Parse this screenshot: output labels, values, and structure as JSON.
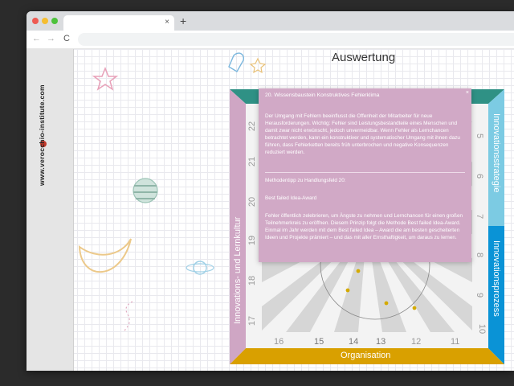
{
  "browser": {
    "tab_close": "×",
    "new_tab": "+",
    "nav": {
      "back": "←",
      "forward": "→",
      "reload": "C"
    }
  },
  "sidebar": {
    "brand": "www.verocchio-institute.com"
  },
  "page": {
    "title": "Auswertung"
  },
  "board": {
    "left_label": "Innovations- und Lernkultur",
    "right_top_label": "Innovationsstrategie",
    "right_bottom_label": "Innovationsprozess",
    "bottom_label": "Organisation",
    "numbers": [
      "16",
      "15",
      "14",
      "13",
      "12",
      "11",
      "17",
      "18",
      "19",
      "20",
      "21",
      "22",
      "5",
      "6",
      "7",
      "8",
      "9",
      "10"
    ],
    "colors": {
      "left": "#cfa6c4",
      "top": "#2f9185",
      "right_top": "#7ccbe3",
      "right_bottom": "#0a93d6",
      "bottom": "#d9a000"
    }
  },
  "modal": {
    "close": "×",
    "heading": "20. Wissensbaustein Konstruktives Fehlerklima",
    "paragraph1": "Der Umgang mit Fehlern beeinflusst die Offenheit der Mitarbeiter für neue Herausforderungen. Wichtig: Fehler sind Leistungsbestandteile eines Menschen und damit zwar nicht erwünscht, jedoch unvermeidbar. Wenn Fehler als Lernchancen betrachtet werden, kann ein konstruktiver und systematischer Umgang mit ihnen dazu führen, dass Fehlerketten bereits früh unterbrochen und negative Konsequenzen reduziert werden.",
    "tip_heading": "Methodentipp zu Handlungsfeld 20:",
    "tip_title": "Best failed Idea-Award",
    "paragraph2": "Fehler öffentlich zelebrieren, um Ängste zu nehmen und Lernchancen für einen großen Teilnehmerkreis zu eröffnen. Diesem Prinzip folgt die Methode Best failed Idea-Award. Einmal im Jahr werden mit dem Best failed Idea – Award die am besten gescheiterten Ideen und Projekte prämiert – und das mit aller Ernsthaftigkeit, um daraus zu lernen."
  }
}
